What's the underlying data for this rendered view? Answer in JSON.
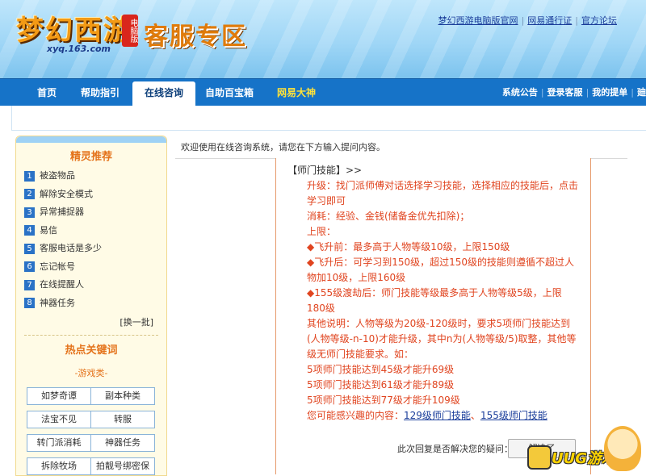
{
  "header": {
    "logo_text": "梦幻西游",
    "logo_badge": "电脑版",
    "logo_url": "xyq.163.com",
    "zone_title": "客服专区",
    "top_links": [
      "梦幻西游电脑版官网",
      "网易通行证",
      "官方论坛"
    ]
  },
  "nav": {
    "tabs": [
      "首页",
      "帮助指引",
      "在线咨询",
      "自助百宝箱",
      "网易大神"
    ],
    "right_links": [
      "系统公告",
      "登录客服",
      "我的提单",
      "廸"
    ]
  },
  "sidebar": {
    "title": "精灵推荐",
    "items": [
      {
        "num": "1",
        "label": "被盗物品"
      },
      {
        "num": "2",
        "label": "解除安全模式"
      },
      {
        "num": "3",
        "label": "异常捕捉器"
      },
      {
        "num": "4",
        "label": "易信"
      },
      {
        "num": "5",
        "label": "客服电话是多少"
      },
      {
        "num": "6",
        "label": "忘记帐号"
      },
      {
        "num": "7",
        "label": "在线提醒人"
      },
      {
        "num": "8",
        "label": "神器任务"
      }
    ],
    "switch_label": "[换一批]",
    "hot_title": "热点关键词",
    "category": "-游戏类-",
    "keywords": [
      "如梦奇谭",
      "副本种类",
      "法宝不见",
      "转服",
      "转门派消耗",
      "神器任务",
      "拆除牧场",
      "拍靓号绑密保"
    ]
  },
  "main": {
    "welcome": "欢迎使用在线咨询系统，请您在下方输入提问内容。",
    "answer": {
      "title": "【师门技能】>>",
      "lines": [
        "升级：找门派师傅对话选择学习技能，选择相应的技能后，点击学习即可",
        "消耗：经验、金钱(储备金优先扣除)；",
        "上限：",
        "◆飞升前：最多高于人物等级10级，上限150级",
        "◆飞升后：可学习到150级，超过150级的技能则遵循不超过人物加10级，上限160级",
        "◆155级渡劫后：师门技能等级最多高于人物等级5级，上限180级",
        "其他说明：人物等级为20级-120级时，要求5项师门技能达到(人物等级-n-10)才能升级，其中n为(人物等级/5)取整，其他等级无师门技能要求。如：",
        "5项师门技能达到45级才能升69级",
        "5项师门技能达到61级才能升89级",
        "5项师门技能达到77级才能升109级"
      ],
      "related_label": "您可能感兴趣的内容：",
      "related_links": [
        "129级师门技能",
        "155级师门技能"
      ]
    },
    "feedback_question": "此次回复是否解决您的疑问：",
    "feedback_button": "解决了",
    "watermark": "UUG游戏网"
  }
}
